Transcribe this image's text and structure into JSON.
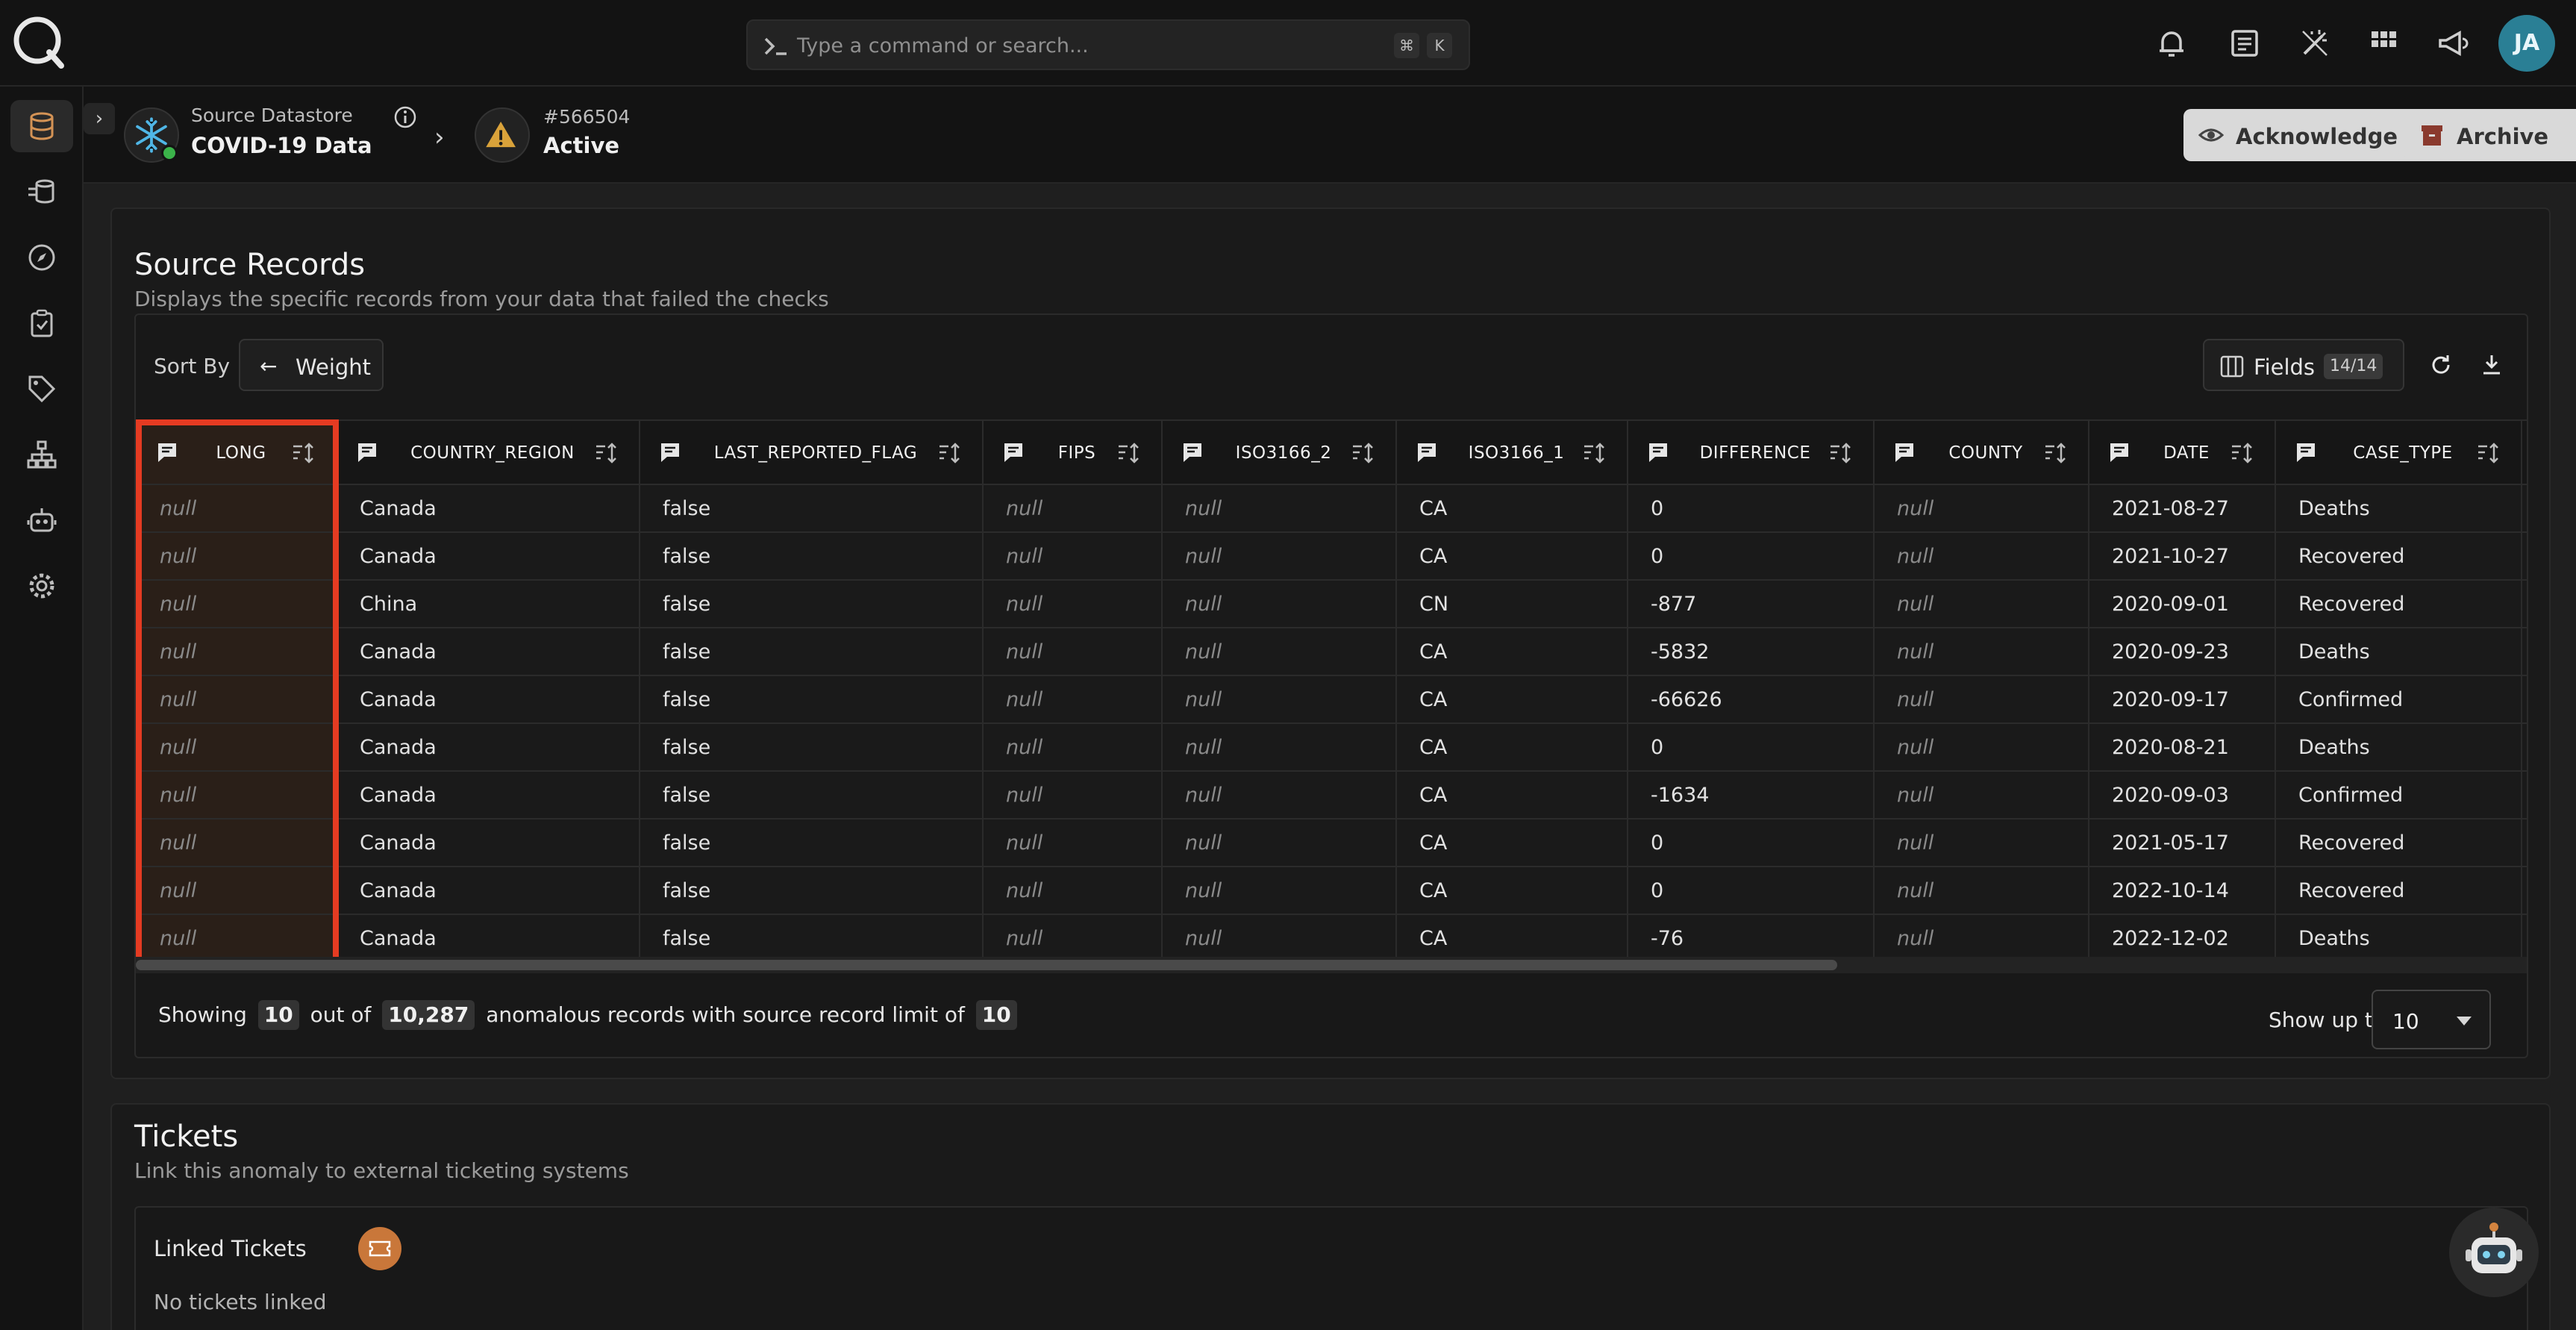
{
  "search": {
    "placeholder": "Type a command or search...",
    "shortcut_1": "⌘",
    "shortcut_2": "K"
  },
  "user": {
    "initials": "JA"
  },
  "header": {
    "datastore_label": "Source Datastore",
    "datastore_name": "COVID-19 Data",
    "anomaly_id": "#566504",
    "anomaly_status": "Active",
    "acknowledge_label": "Acknowledge",
    "archive_label": "Archive"
  },
  "source_records": {
    "title": "Source Records",
    "subtitle": "Displays the specific records from your data that failed the checks",
    "sort_by_label": "Sort By",
    "sort_value": "Weight",
    "fields_label": "Fields",
    "fields_count": "14/14",
    "columns": [
      "LONG",
      "COUNTRY_REGION",
      "LAST_REPORTED_FLAG",
      "FIPS",
      "ISO3166_2",
      "ISO3166_1",
      "DIFFERENCE",
      "COUNTY",
      "DATE",
      "CASE_TYPE"
    ],
    "rows": [
      [
        "null",
        "Canada",
        "false",
        "null",
        "null",
        "CA",
        "0",
        "null",
        "2021-08-27",
        "Deaths"
      ],
      [
        "null",
        "Canada",
        "false",
        "null",
        "null",
        "CA",
        "0",
        "null",
        "2021-10-27",
        "Recovered"
      ],
      [
        "null",
        "China",
        "false",
        "null",
        "null",
        "CN",
        "-877",
        "null",
        "2020-09-01",
        "Recovered"
      ],
      [
        "null",
        "Canada",
        "false",
        "null",
        "null",
        "CA",
        "-5832",
        "null",
        "2020-09-23",
        "Deaths"
      ],
      [
        "null",
        "Canada",
        "false",
        "null",
        "null",
        "CA",
        "-66626",
        "null",
        "2020-09-17",
        "Confirmed"
      ],
      [
        "null",
        "Canada",
        "false",
        "null",
        "null",
        "CA",
        "0",
        "null",
        "2020-08-21",
        "Deaths"
      ],
      [
        "null",
        "Canada",
        "false",
        "null",
        "null",
        "CA",
        "-1634",
        "null",
        "2020-09-03",
        "Confirmed"
      ],
      [
        "null",
        "Canada",
        "false",
        "null",
        "null",
        "CA",
        "0",
        "null",
        "2021-05-17",
        "Recovered"
      ],
      [
        "null",
        "Canada",
        "false",
        "null",
        "null",
        "CA",
        "0",
        "null",
        "2022-10-14",
        "Recovered"
      ],
      [
        "null",
        "Canada",
        "false",
        "null",
        "null",
        "CA",
        "-76",
        "null",
        "2022-12-02",
        "Deaths"
      ]
    ],
    "footer": {
      "showing_prefix": "Showing",
      "showing_count": "10",
      "out_of_label": "out of",
      "total": "10,287",
      "middle_text": "anomalous records with source record limit of",
      "limit": "10",
      "show_up_to_label": "Show up to",
      "show_up_to_value": "10"
    }
  },
  "tickets": {
    "title": "Tickets",
    "subtitle": "Link this anomaly to external ticketing systems",
    "linked_label": "Linked Tickets",
    "empty_text": "No tickets linked"
  },
  "colors": {
    "accent": "#c9773a",
    "highlight_border": "#e53b22",
    "status_ok": "#3bb34a",
    "warning": "#d9a23a"
  }
}
